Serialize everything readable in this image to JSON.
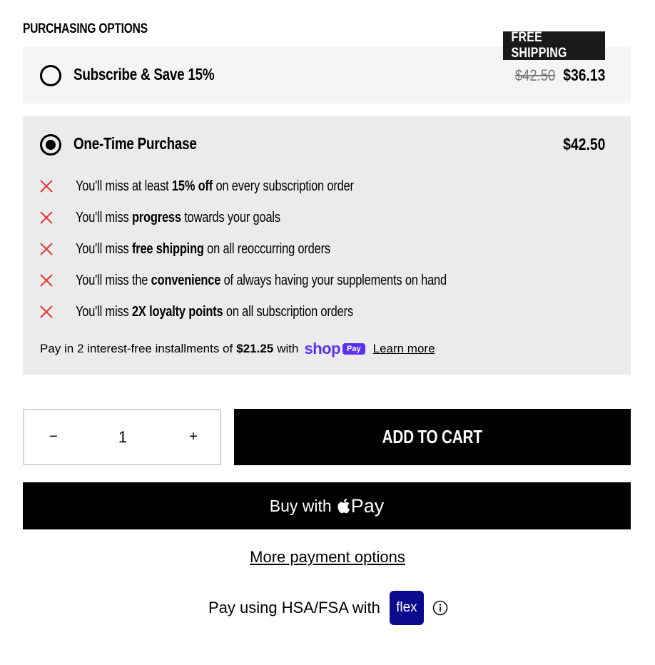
{
  "purchasing": {
    "title": "PURCHASING OPTIONS",
    "subscribe": {
      "badge": "FREE SHIPPING",
      "label": "Subscribe & Save 15%",
      "old_price": "$42.50",
      "price": "$36.13",
      "selected": false
    },
    "one_time": {
      "label": "One-Time Purchase",
      "price": "$42.50",
      "selected": true,
      "misses": [
        {
          "pre": "You'll miss at least ",
          "bold": "15% off",
          "post": " on every subscription order"
        },
        {
          "pre": "You'll miss ",
          "bold": "progress",
          "post": " towards your goals"
        },
        {
          "pre": "You'll miss ",
          "bold": "free shipping",
          "post": " on all reoccurring orders"
        },
        {
          "pre": "You'll miss the ",
          "bold": "convenience",
          "post": " of always having your supplements on hand"
        },
        {
          "pre": "You'll miss ",
          "bold": "2X loyalty points",
          "post": " on all subscription orders"
        }
      ],
      "miss_icon": "x-icon",
      "installments": {
        "pre": "Pay in 2 interest-free installments of",
        "amount": "$21.25",
        "post": "with",
        "shop_word": "shop",
        "pay_pill": "Pay",
        "learn_more": "Learn more"
      }
    }
  },
  "cart": {
    "minus": "−",
    "quantity": "1",
    "plus": "+",
    "add_to_cart": "ADD TO CART",
    "apple_pay_prefix": "Buy with",
    "apple_pay_word": "Pay",
    "more_payment": "More payment options"
  },
  "hsa": {
    "text": "Pay using HSA/FSA with",
    "flex_label": "flex"
  },
  "colors": {
    "accent_x": "#e53935",
    "shop_purple": "#5a31f4",
    "flex_navy": "#0a0a8c"
  }
}
